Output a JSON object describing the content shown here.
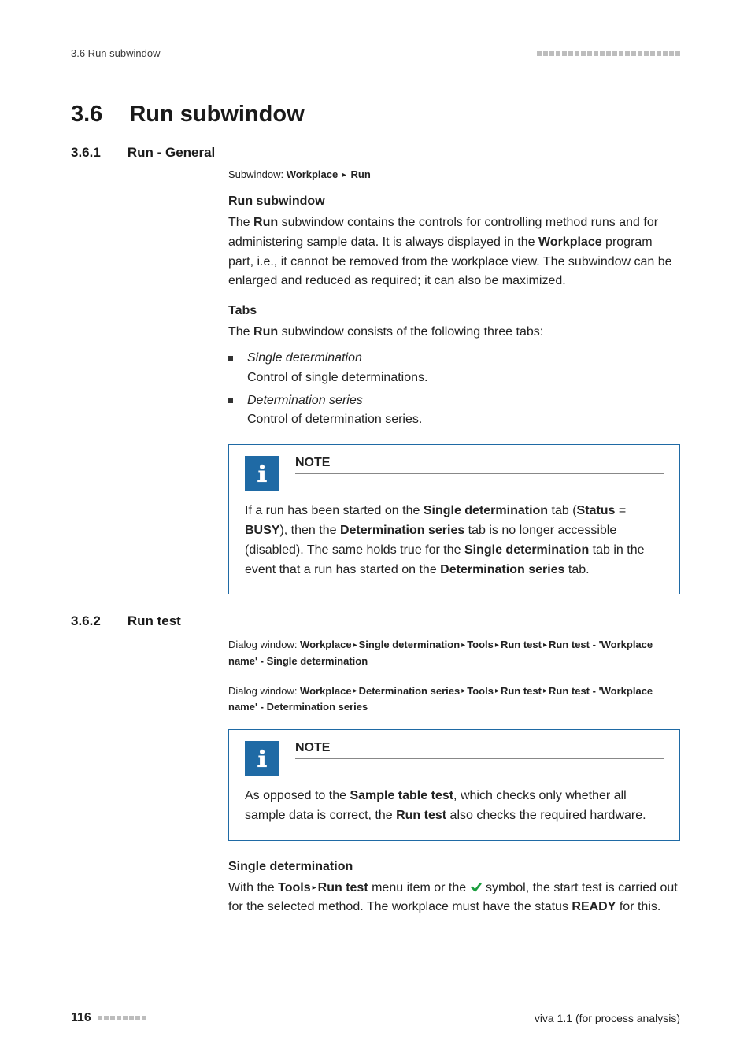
{
  "header": {
    "running": "3.6 Run subwindow"
  },
  "sec36": {
    "num": "3.6",
    "title": "Run subwindow"
  },
  "sec361": {
    "num": "3.6.1",
    "title": "Run - General",
    "crumb_label": "Subwindow: ",
    "crumb_a": "Workplace",
    "crumb_b": "Run",
    "h_runsub": "Run subwindow",
    "p1a": "The ",
    "p1b": "Run",
    "p1c": " subwindow contains the controls for controlling method runs and for administering sample data. It is always displayed in the ",
    "p1d": "Workplace",
    "p1e": " program part, i.e., it cannot be removed from the workplace view. The subwindow can be enlarged and reduced as required; it can also be maximized.",
    "h_tabs": "Tabs",
    "p2a": "The ",
    "p2b": "Run",
    "p2c": " subwindow consists of the following three tabs:",
    "bullets": [
      {
        "title": "Single determination",
        "desc": "Control of single determinations."
      },
      {
        "title": "Determination series",
        "desc": "Control of determination series."
      }
    ],
    "note_title": "NOTE",
    "note_a": "If a run has been started on the ",
    "note_b": "Single determination",
    "note_c": " tab (",
    "note_d": "Status",
    "note_e": " = ",
    "note_f": "BUSY",
    "note_g": "), then the ",
    "note_h": "Determination series",
    "note_i": " tab is no longer accessible (disabled). The same holds true for the ",
    "note_j": "Single determination",
    "note_k": " tab in the event that a run has started on the ",
    "note_l": "Determination series",
    "note_m": " tab."
  },
  "sec362": {
    "num": "3.6.2",
    "title": "Run test",
    "crumb1_label": "Dialog window: ",
    "crumb1_parts": [
      "Workplace",
      "Single determination",
      "Tools",
      "Run test",
      "Run test - 'Workplace name' - Single determination"
    ],
    "crumb2_label": "Dialog window: ",
    "crumb2_parts": [
      "Workplace",
      "Determination series",
      "Tools",
      "Run test",
      "Run test - 'Workplace name' - Determination series"
    ],
    "note_title": "NOTE",
    "note_a": "As opposed to the ",
    "note_b": "Sample table test",
    "note_c": ", which checks only whether all sample data is correct, the ",
    "note_d": "Run test",
    "note_e": " also checks the required hardware.",
    "h_single": "Single determination",
    "p1a": "With the ",
    "p1b": "Tools",
    "p1c": "Run test",
    "p1d": " menu item or the ",
    "p1e": " symbol, the start test is carried out for the selected method. The workplace must have the status ",
    "p1f": "READY",
    "p1g": " for this."
  },
  "footer": {
    "page": "116",
    "product": "viva 1.1 (for process analysis)"
  }
}
